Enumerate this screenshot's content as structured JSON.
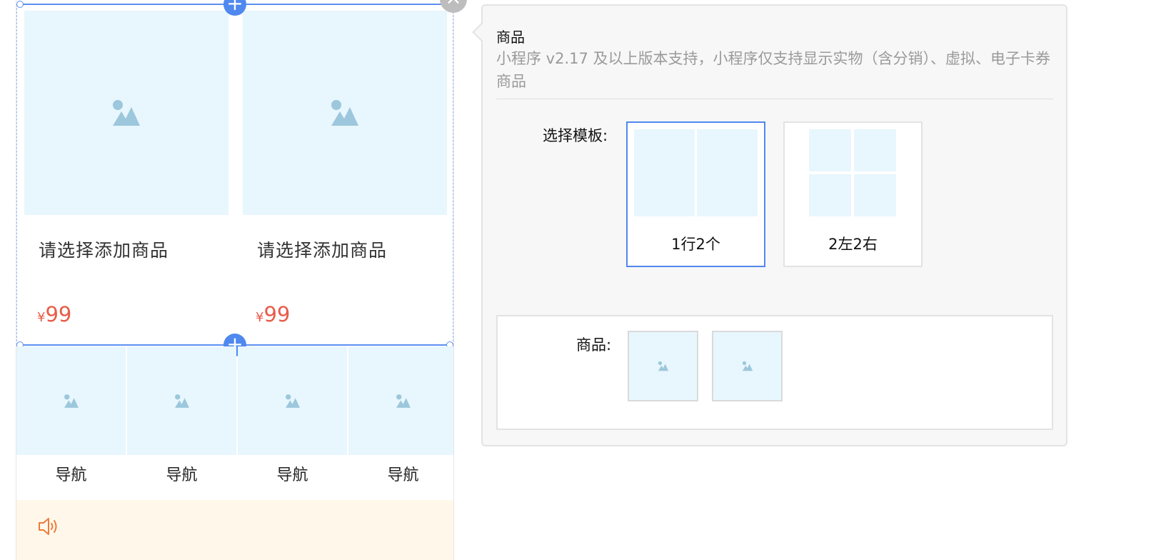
{
  "preview": {
    "goods": [
      {
        "name": "请选择添加商品",
        "currency": "¥",
        "price": "99"
      },
      {
        "name": "请选择添加商品",
        "currency": "¥",
        "price": "99"
      }
    ],
    "nav_items": [
      {
        "label": "导航"
      },
      {
        "label": "导航"
      },
      {
        "label": "导航"
      },
      {
        "label": "导航"
      }
    ],
    "add_symbol": "+",
    "close_symbol": "×",
    "notice_icon": "speaker-icon"
  },
  "panel": {
    "title": "商品",
    "description": "小程序 v2.17 及以上版本支持，小程序仅支持显示实物（含分销）、虚拟、电子卡券商品",
    "template_label": "选择模板:",
    "templates": [
      {
        "label": "1行2个",
        "selected": true
      },
      {
        "label": "2左2右",
        "selected": false
      }
    ],
    "goods_label": "商品:",
    "goods_thumbs": [
      "image-placeholder-icon",
      "image-placeholder-icon"
    ]
  },
  "colors": {
    "accent": "#4f88ee",
    "price": "#e85c4a",
    "placeholder_bg": "#e8f6fd",
    "placeholder_icon": "#9cc7dc",
    "notice_bg": "#fff8ea",
    "notice_icon": "#ef7a3a"
  }
}
